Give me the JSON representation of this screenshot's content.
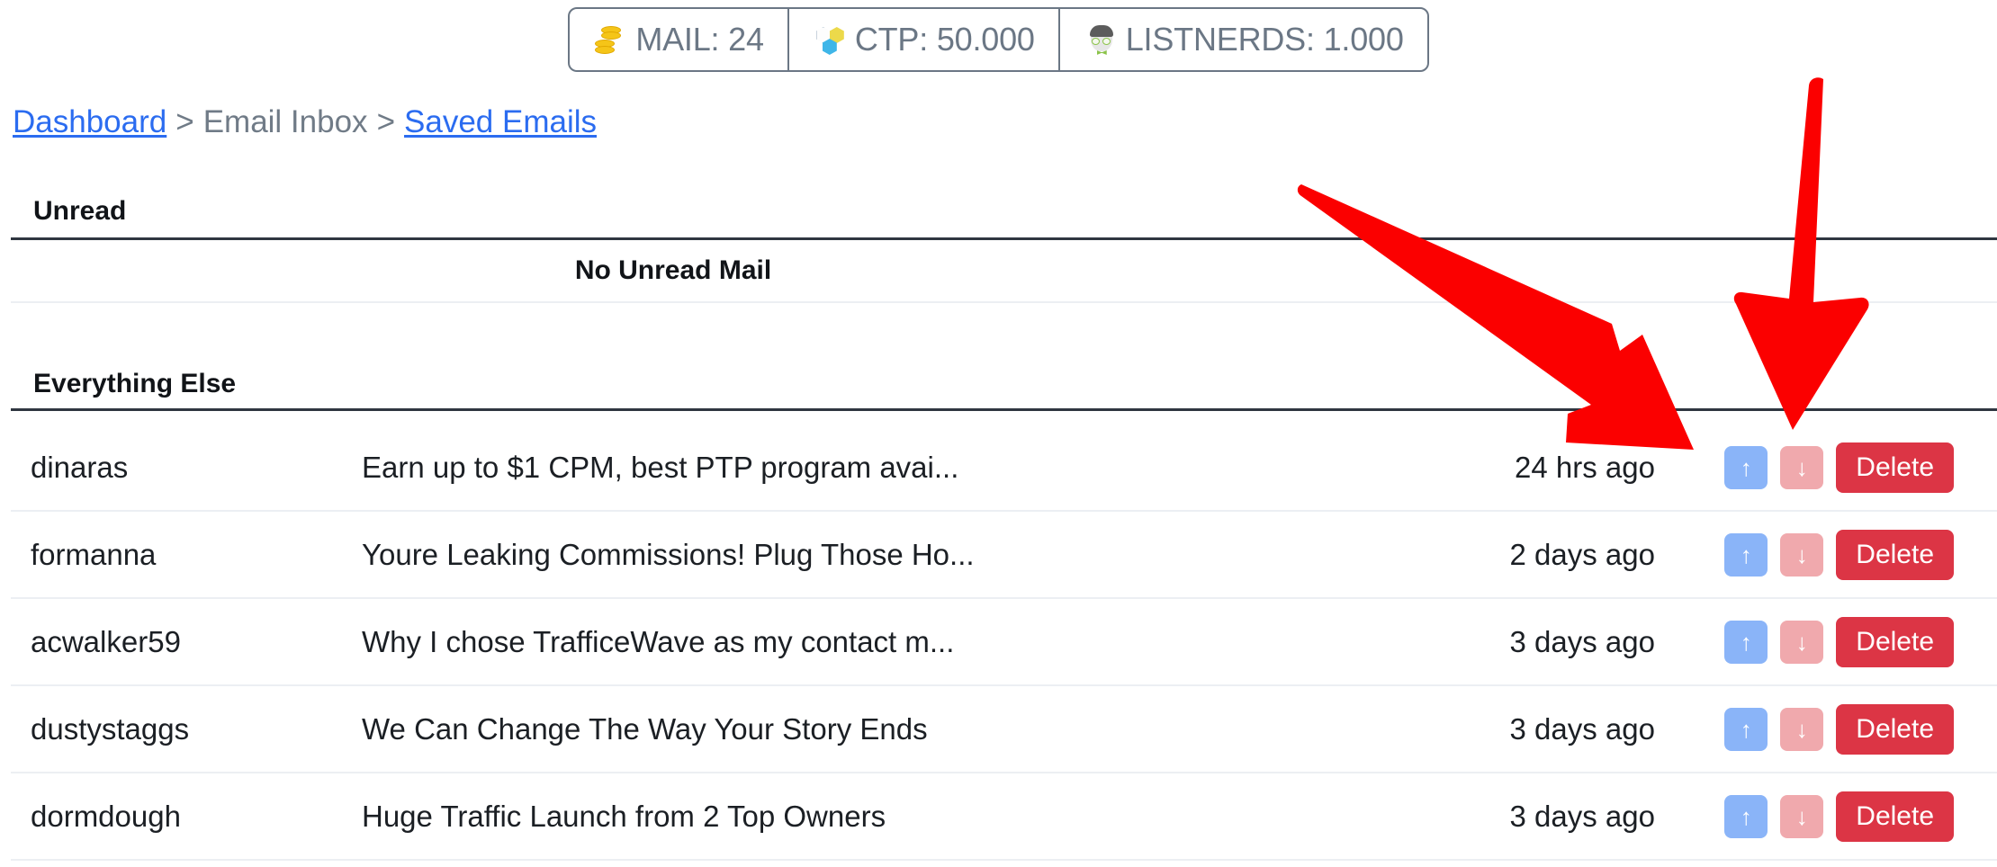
{
  "statbar": {
    "items": [
      {
        "icon": "coins-icon",
        "label": "MAIL: 24"
      },
      {
        "icon": "ctp-logo-icon",
        "label": "CTP: 50.000"
      },
      {
        "icon": "nerd-face-icon",
        "label": "LISTNERDS: 1.000"
      }
    ]
  },
  "breadcrumb": {
    "dashboard": "Dashboard",
    "sep1": ">",
    "email_inbox": "Email Inbox",
    "sep2": ">",
    "saved_emails": "Saved Emails"
  },
  "unread": {
    "title": "Unread",
    "empty_message": "No Unread Mail"
  },
  "everything_else": {
    "title": "Everything Else",
    "rows": [
      {
        "sender": "dinaras",
        "subject": "Earn up to $1 CPM, best PTP program avai...",
        "time": "24 hrs ago",
        "up": "↑",
        "down": "↓",
        "delete": "Delete"
      },
      {
        "sender": "formanna",
        "subject": "Youre Leaking Commissions! Plug Those Ho...",
        "time": "2 days ago",
        "up": "↑",
        "down": "↓",
        "delete": "Delete"
      },
      {
        "sender": "acwalker59",
        "subject": "Why I chose TrafficeWave as my contact m...",
        "time": "3 days ago",
        "up": "↑",
        "down": "↓",
        "delete": "Delete"
      },
      {
        "sender": "dustystaggs",
        "subject": "We Can Change The Way Your Story Ends",
        "time": "3 days ago",
        "up": "↑",
        "down": "↓",
        "delete": "Delete"
      },
      {
        "sender": "dormdough",
        "subject": "Huge Traffic Launch from 2 Top Owners",
        "time": "3 days ago",
        "up": "↑",
        "down": "↓",
        "delete": "Delete"
      }
    ]
  },
  "colors": {
    "link": "#2b6cf0",
    "muted_text": "#707b87",
    "delete_button": "#dc3545",
    "up_button": "#8ab4f8",
    "down_button": "#f0a9ad",
    "annotation_arrow": "#fb0000",
    "statbar_border": "#6b7785"
  }
}
